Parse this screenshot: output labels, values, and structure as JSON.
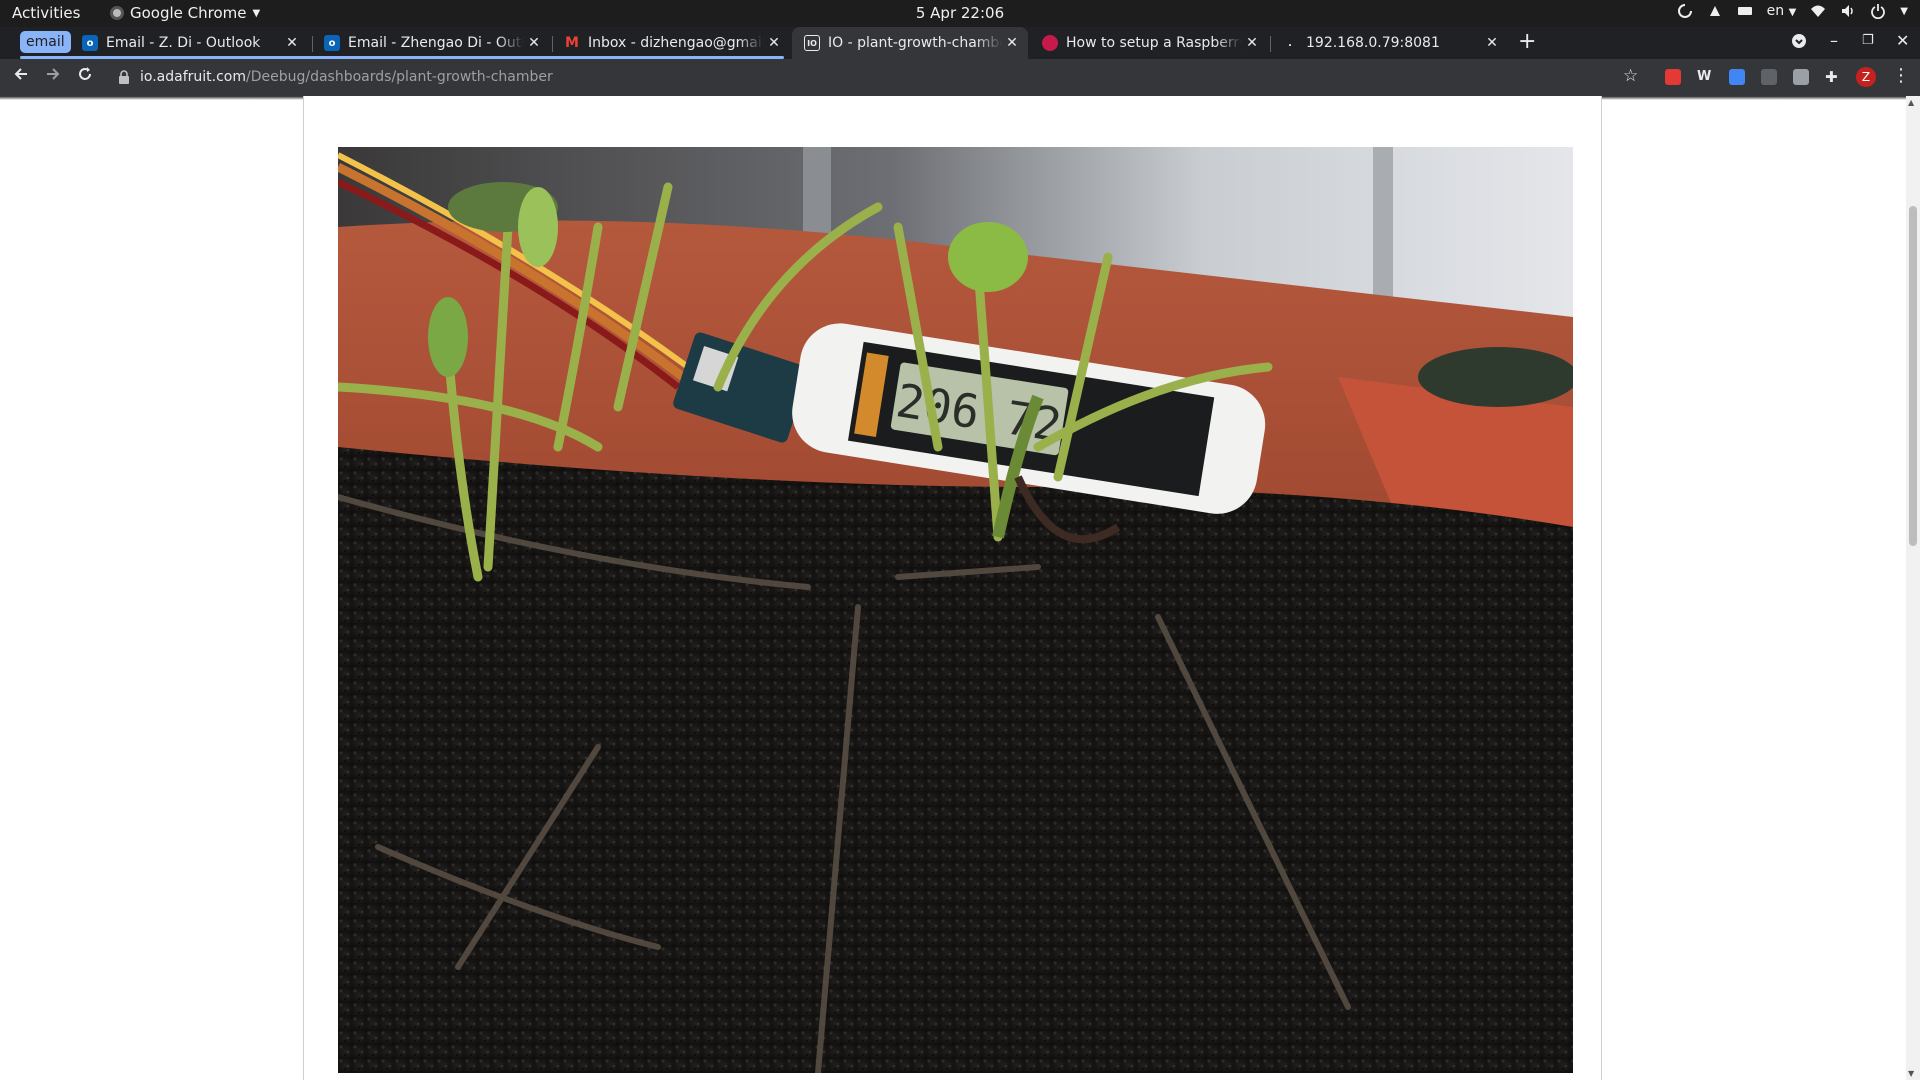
{
  "system_bar": {
    "activities": "Activities",
    "app_name": "Google Chrome",
    "clock": "5 Apr  22:06",
    "language": "en"
  },
  "tabs": {
    "group_label": "email",
    "items": [
      {
        "title": "Email - Z. Di - Outlook",
        "favicon": "outlook-icon"
      },
      {
        "title": "Email - Zhengao Di - Outlook",
        "favicon": "outlook-icon"
      },
      {
        "title": "Inbox - dizhengao@gmail.com",
        "favicon": "gmail-icon"
      },
      {
        "title": "IO - plant-growth-chamber",
        "favicon": "adafruit-io-icon",
        "active": true
      },
      {
        "title": "How to setup a Raspberry Pi",
        "favicon": "raspberry-icon"
      },
      {
        "title": "192.168.0.79:8081",
        "favicon": "blank-page-icon"
      }
    ]
  },
  "address_bar": {
    "domain": "io.adafruit.com",
    "path": "/Deebug/dashboards/plant-growth-chamber"
  },
  "profile": {
    "initial": "Z"
  },
  "dashboard": {
    "image_meter_reading": "206.72"
  },
  "colors": {
    "tab_group": "#8ab4f8",
    "toolbar": "#35363a",
    "tabstrip": "#202124",
    "avatar": "#c5221f"
  }
}
